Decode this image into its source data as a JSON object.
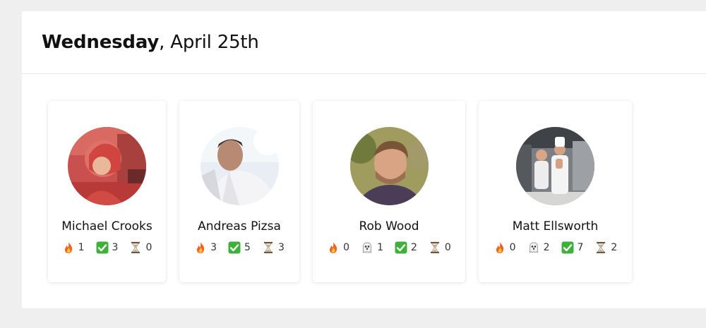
{
  "header": {
    "day": "Wednesday",
    "date": ", April 25th"
  },
  "colors": {
    "fire": "#f0621f",
    "check": "#3fb03a",
    "ghost": "#d9d9d9",
    "hourglass": "#6b4a2b"
  },
  "people": [
    {
      "name": "Michael Crooks",
      "stats": [
        {
          "icon": "fire-icon",
          "value": "1"
        },
        {
          "icon": "check-icon",
          "value": "3"
        },
        {
          "icon": "hourglass-icon",
          "value": "0"
        }
      ]
    },
    {
      "name": "Andreas Pizsa",
      "stats": [
        {
          "icon": "fire-icon",
          "value": "3"
        },
        {
          "icon": "check-icon",
          "value": "5"
        },
        {
          "icon": "hourglass-icon",
          "value": "3"
        }
      ]
    },
    {
      "name": "Rob Wood",
      "stats": [
        {
          "icon": "fire-icon",
          "value": "0"
        },
        {
          "icon": "ghost-icon",
          "value": "1"
        },
        {
          "icon": "check-icon",
          "value": "2"
        },
        {
          "icon": "hourglass-icon",
          "value": "0"
        }
      ]
    },
    {
      "name": "Matt Ellsworth",
      "stats": [
        {
          "icon": "fire-icon",
          "value": "0"
        },
        {
          "icon": "ghost-icon",
          "value": "2"
        },
        {
          "icon": "check-icon",
          "value": "7"
        },
        {
          "icon": "hourglass-icon",
          "value": "2"
        }
      ]
    }
  ]
}
